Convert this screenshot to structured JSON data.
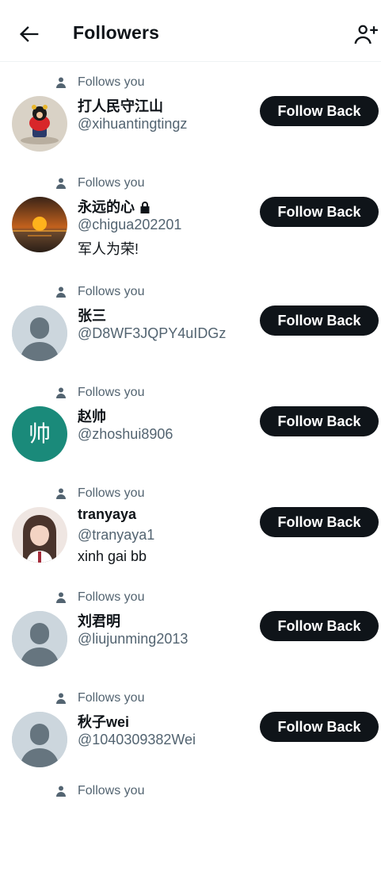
{
  "header": {
    "title": "Followers"
  },
  "follows_label": "Follows you",
  "follow_back_label": "Follow Back",
  "followers": [
    {
      "name": "打人民守江山",
      "handle": "@xihuantingtingz",
      "bio": "",
      "locked": false,
      "avatar": "photo-figurine"
    },
    {
      "name": "永远的心",
      "handle": "@chigua202201",
      "bio": "军人为荣!",
      "locked": true,
      "avatar": "photo-sunset"
    },
    {
      "name": "张三",
      "handle": "@D8WF3JQPY4uIDGz",
      "bio": "",
      "locked": false,
      "avatar": "default"
    },
    {
      "name": "赵帅",
      "handle": "@zhoshui8906",
      "bio": "",
      "locked": false,
      "avatar": "letter",
      "avatar_text": "帅"
    },
    {
      "name": "tranyaya",
      "handle": "@tranyaya1",
      "bio": "xinh gai bb",
      "locked": false,
      "avatar": "photo-girl"
    },
    {
      "name": "刘君明",
      "handle": "@liujunming2013",
      "bio": "",
      "locked": false,
      "avatar": "default"
    },
    {
      "name": "秋子wei",
      "handle": "@1040309382Wei",
      "bio": "",
      "locked": false,
      "avatar": "default"
    }
  ],
  "colors": {
    "text": "#0f1419",
    "secondary": "#536471",
    "button": "#0f1419",
    "avatar_default": "#ccd6dd",
    "avatar_letter": "#1a8a7a"
  }
}
